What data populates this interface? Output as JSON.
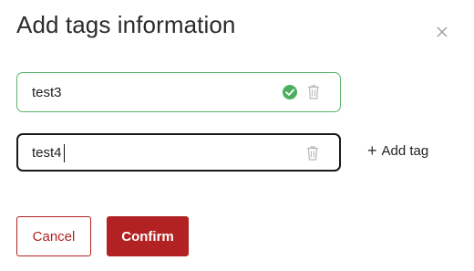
{
  "dialog": {
    "title": "Add tags information",
    "close_icon": "close-icon"
  },
  "tags": [
    {
      "value": "test3",
      "status": "valid",
      "status_icon": "check-circle-icon",
      "delete_icon": "trash-icon"
    },
    {
      "value": "test4",
      "status": "editing",
      "delete_icon": "trash-icon"
    }
  ],
  "add_tag": {
    "icon": "plus-icon",
    "label": "Add tag"
  },
  "buttons": {
    "cancel_label": "Cancel",
    "confirm_label": "Confirm"
  },
  "colors": {
    "accent": "#b22222",
    "valid": "#5bb36b",
    "active_border": "#1a1a1a"
  }
}
